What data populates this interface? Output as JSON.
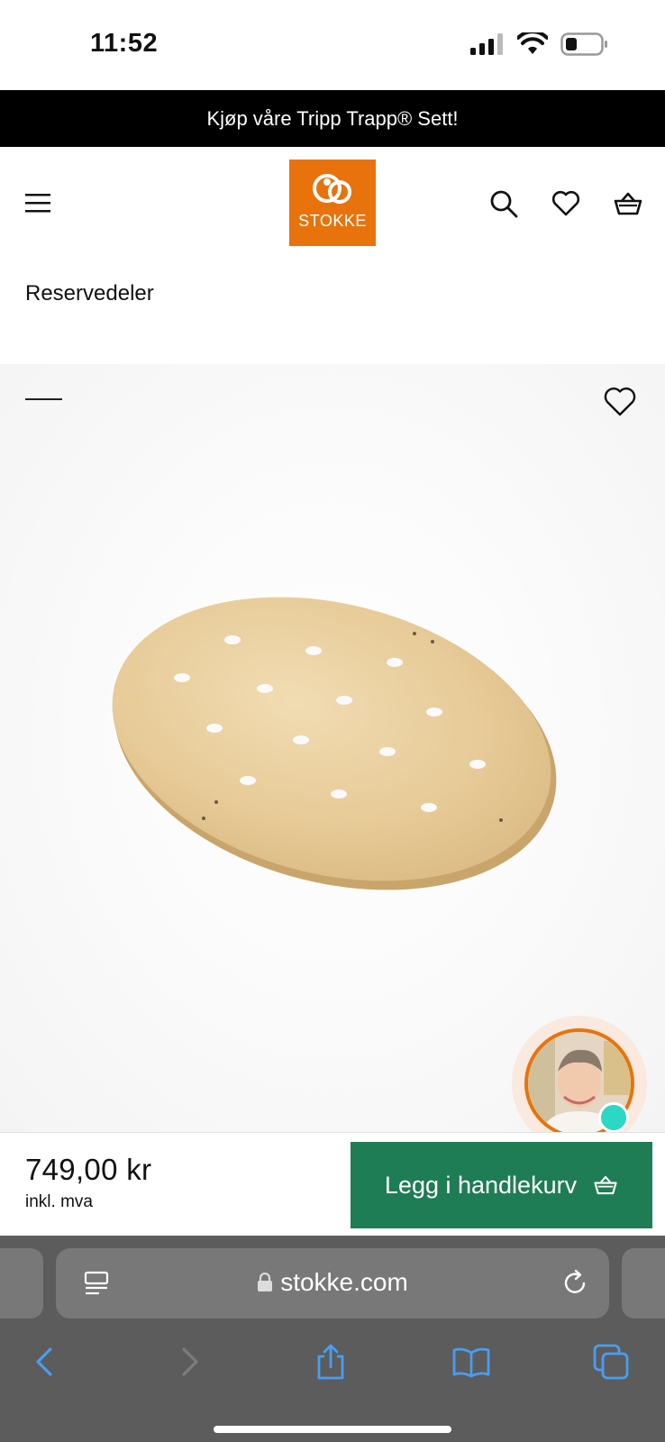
{
  "status_bar": {
    "time": "11:52"
  },
  "promo_banner": {
    "text": "Kjøp våre Tripp Trapp® Sett!"
  },
  "header": {
    "logo_text": "STOKKE",
    "icons": [
      "menu-icon",
      "search-icon",
      "heart-icon",
      "basket-icon"
    ]
  },
  "breadcrumb": {
    "label": "Reservedeler"
  },
  "gallery": {
    "icons": [
      "heart-icon"
    ],
    "product_image": "oval plywood board with holes"
  },
  "purchase": {
    "price": "749,00 kr",
    "vat_note": "inkl. mva",
    "add_to_cart_label": "Legg i handlekurv"
  },
  "browser": {
    "url": "stokke.com",
    "toolbar_icons": [
      "back-icon",
      "forward-icon",
      "share-icon",
      "bookmarks-icon",
      "tabs-icon"
    ]
  },
  "colors": {
    "brand_orange": "#e8730c",
    "cart_green": "#1e7d54",
    "chat_online": "#2ad8c4"
  }
}
